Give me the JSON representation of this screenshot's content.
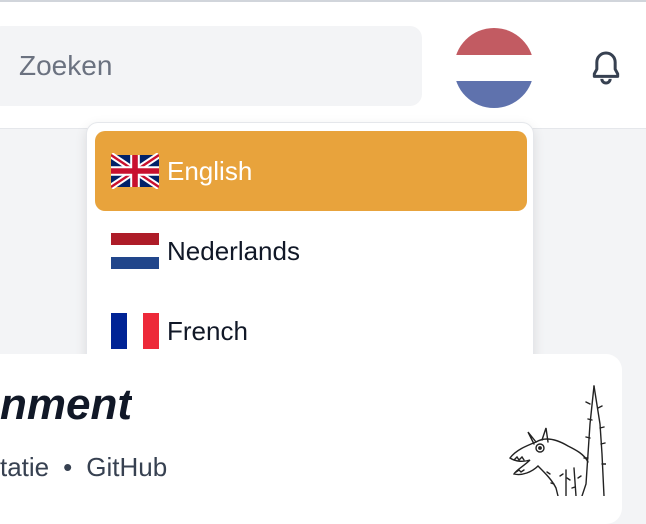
{
  "header": {
    "search_placeholder": "Zoeken",
    "language_button": {
      "current": "Nederlands",
      "flag_colors": [
        "#c25b62",
        "#ffffff",
        "#5f72ad"
      ]
    },
    "notification_icon": "bell-icon"
  },
  "language_menu": {
    "items": [
      {
        "label": "English",
        "flag": "uk-flag-icon",
        "active": true
      },
      {
        "label": "Nederlands",
        "flag": "nl-flag-icon",
        "active": false
      },
      {
        "label": "French",
        "flag": "fr-flag-icon",
        "active": false
      }
    ],
    "active_color": "#e8a33c"
  },
  "card": {
    "title_fragment": "nment",
    "links": [
      "tatie",
      "GitHub"
    ],
    "separator": "•",
    "illustration": "wolf-mascot-icon"
  }
}
